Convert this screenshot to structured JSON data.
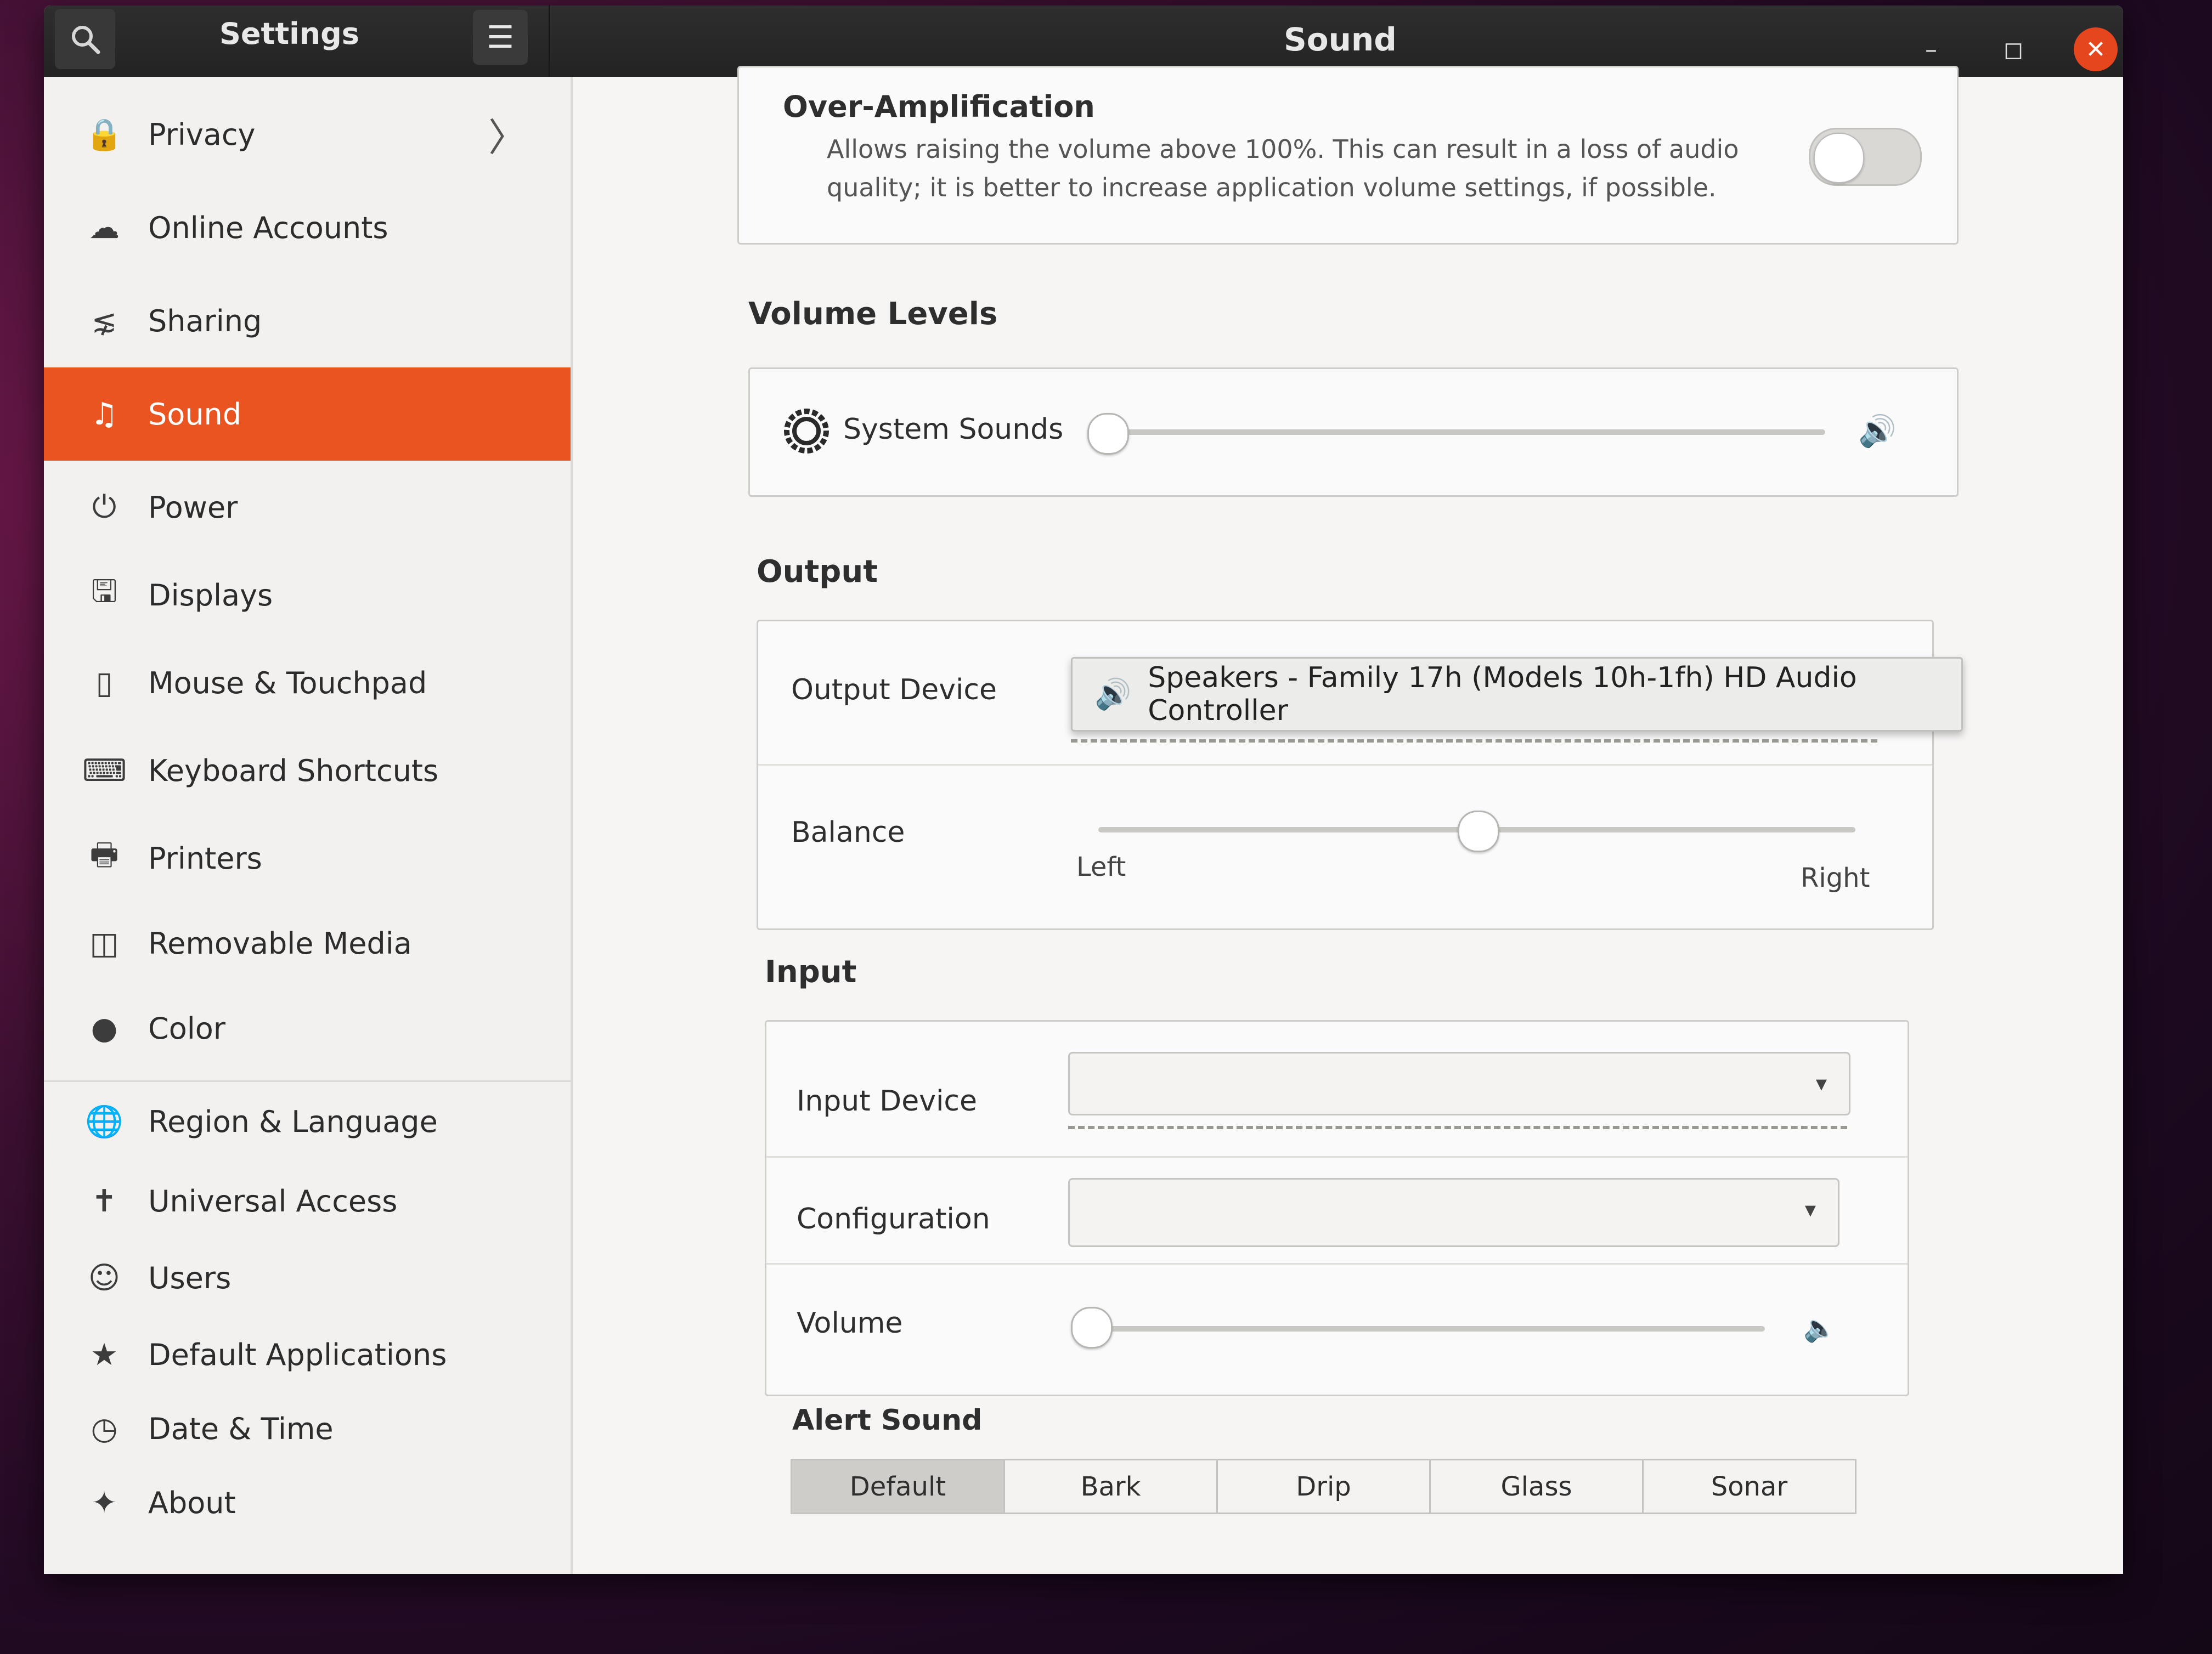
{
  "headerbar": {
    "app_title": "Settings",
    "page_title": "Sound"
  },
  "sidebar": {
    "items": [
      {
        "label": "Privacy",
        "icon": "lock-icon"
      },
      {
        "label": "Online Accounts",
        "icon": "cloud-icon"
      },
      {
        "label": "Sharing",
        "icon": "share-icon"
      },
      {
        "label": "Sound",
        "icon": "music-note-icon"
      },
      {
        "label": "Power",
        "icon": "power-icon"
      },
      {
        "label": "Displays",
        "icon": "display-icon"
      },
      {
        "label": "Mouse & Touchpad",
        "icon": "mouse-icon"
      },
      {
        "label": "Keyboard Shortcuts",
        "icon": "keyboard-icon"
      },
      {
        "label": "Printers",
        "icon": "printer-icon"
      },
      {
        "label": "Removable Media",
        "icon": "removable-media-icon"
      },
      {
        "label": "Color",
        "icon": "color-icon"
      },
      {
        "label": "Region & Language",
        "icon": "globe-icon"
      },
      {
        "label": "Universal Access",
        "icon": "accessibility-icon"
      },
      {
        "label": "Users",
        "icon": "user-icon"
      },
      {
        "label": "Default Applications",
        "icon": "star-icon"
      },
      {
        "label": "Date & Time",
        "icon": "clock-icon"
      },
      {
        "label": "About",
        "icon": "sparkle-icon"
      }
    ],
    "active": "Sound",
    "accent_color": "#e95420"
  },
  "over_amplification": {
    "title": "Over-Amplification",
    "description_line1": "Allows raising the volume above 100%. This can result in a loss of audio",
    "description_line2": "quality; it is better to increase application volume settings, if possible.",
    "enabled": false
  },
  "volume_levels": {
    "heading": "Volume Levels",
    "system_sounds_label": "System Sounds",
    "system_sounds_level": 0.0
  },
  "output": {
    "heading": "Output",
    "device_label": "Output Device",
    "device_value": "Speakers - Family 17h (Models 10h-1fh) HD Audio Controller",
    "balance_label": "Balance",
    "balance_left": "Left",
    "balance_right": "Right",
    "balance_level": 0.5
  },
  "input": {
    "heading": "Input",
    "device_label": "Input Device",
    "device_value": "",
    "configuration_label": "Configuration",
    "configuration_value": "",
    "volume_label": "Volume",
    "volume_level": 0.0
  },
  "alert_sound": {
    "heading": "Alert Sound",
    "options": [
      "Default",
      "Bark",
      "Drip",
      "Glass",
      "Sonar"
    ],
    "selected": "Default"
  }
}
